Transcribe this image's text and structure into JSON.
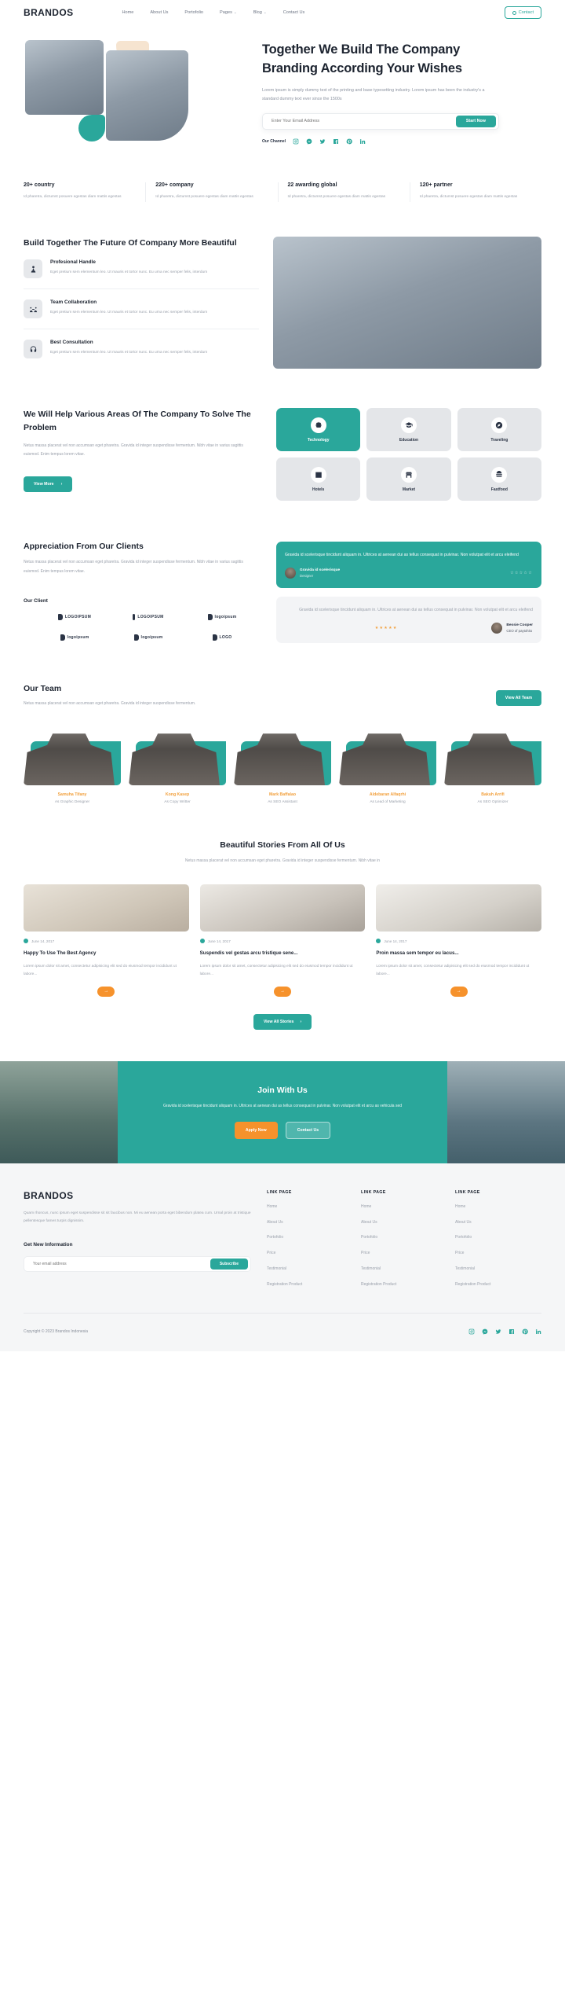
{
  "nav": {
    "brand": "BRANDOS",
    "links": [
      {
        "label": "Home",
        "dropdown": false
      },
      {
        "label": "About Us",
        "dropdown": false
      },
      {
        "label": "Portofolio",
        "dropdown": false
      },
      {
        "label": "Pages",
        "dropdown": true
      },
      {
        "label": "Blog",
        "dropdown": true
      },
      {
        "label": "Contact Us",
        "dropdown": false
      }
    ],
    "cta": "Contact",
    "cta_icon": "phone-icon"
  },
  "hero": {
    "title": "Together We Build The Company Branding According Your Wishes",
    "paragraph": "Lorem ipsum is simply dummy text of the printing and base typesetting industry. Lorem ipsum has been the industry's a standard dummy text ever since the 1500s",
    "email_placeholder": "Enter Your Email Address",
    "email_value": "",
    "cta": "Start Now",
    "channel_label": "Our Channel",
    "socials": [
      "instagram-icon",
      "messenger-icon",
      "twitter-icon",
      "facebook-icon",
      "pinterest-icon",
      "linkedin-icon"
    ]
  },
  "stats": [
    {
      "value": "20+ country",
      "desc": "Id pharetra, dictumst posuere egestas diam mattis egestas"
    },
    {
      "value": "220+ company",
      "desc": "Id pharetra, dictumst posuere egestas diam mattis egestas"
    },
    {
      "value": "22 awarding global",
      "desc": "Id pharetra, dictumst posuere egestas diam mattis egestas"
    },
    {
      "value": "120+ partner",
      "desc": "Id pharetra, dictumst posuere egestas diam mattis egestas"
    }
  ],
  "build": {
    "title": "Build Together The Future Of Company More Beautiful",
    "features": [
      {
        "icon": "person-tie-icon",
        "title": "Profesional Handle",
        "desc": "Eget pretium sem elementum leo. Ut mauris et tortor nunc. Eu urna nec semper felis, interdum"
      },
      {
        "icon": "team-icon",
        "title": "Team Collaboration",
        "desc": "Eget pretium sem elementum leo. Ut mauris et tortor nunc. Eu urna nec semper felis, interdum"
      },
      {
        "icon": "headset-icon",
        "title": "Best Consultation",
        "desc": "Eget pretium sem elementum leo. Ut mauris et tortor nunc. Eu urna nec semper felis, interdum"
      }
    ]
  },
  "solve": {
    "title": "We Will Help Various Areas Of The Company To Solve The Problem",
    "paragraph": "Netus massa placerat vel non accumsan eget pharetra. Gravida id integer suspendisse fermentum. Nibh vitae in varius sagittis euismod. Enim tempus lorem vitae.",
    "button": "View More",
    "categories": [
      {
        "label": "Technology",
        "icon": "robot-icon",
        "active": true
      },
      {
        "label": "Education",
        "icon": "graduation-cap-icon",
        "active": false
      },
      {
        "label": "Traveling",
        "icon": "compass-icon",
        "active": false
      },
      {
        "label": "Hotels",
        "icon": "hotel-icon",
        "active": false
      },
      {
        "label": "Market",
        "icon": "store-icon",
        "active": false
      },
      {
        "label": "Fastfood",
        "icon": "burger-icon",
        "active": false
      }
    ]
  },
  "testimonial": {
    "title": "Appreciation From Our Clients",
    "paragraph": "Netus massa placerat vel non accumsan eget pharetra. Gravida id integer suspendisse fermentum. Nibh vitae in varius sagittis euismod. Enim tempus lorem vitae.",
    "client_title": "Our Client",
    "client_logos": [
      "LOGOIPSUM",
      "LOGOIPSUM",
      "logoipsum",
      "logoipsum",
      "logoipsum",
      "LOGO"
    ],
    "cards": [
      {
        "text": "Gravida id scelerisque tincidunt aliquam in. Ultrices at aenean dui as tellus consequat in pulvinar. Non volutpat elit et arcu eleifend",
        "name": "Gravida id scelerisque",
        "role": "Designer",
        "stars": "☆☆☆☆☆",
        "theme": "teal"
      },
      {
        "text": "Gravida id scelerisque tincidunt aliquam in. Ultrices at aenean dui as tellus consequat in pulvinar. Non volutpat elit et arcu eleifend",
        "name": "Bessie Cooper",
        "role": "CEO of paytohito",
        "stars": "★★★★★",
        "theme": "grey"
      }
    ]
  },
  "team": {
    "title": "Our Team",
    "paragraph": "Netus massa placerat vel non accumsan eget pharetra. Gravida id integer suspendisse fermentum.",
    "button": "View All Team",
    "members": [
      {
        "name": "Samuha Tifany",
        "role": "As Graphic Designer"
      },
      {
        "name": "Kong Kasep",
        "role": "As Copy Writter"
      },
      {
        "name": "Mark Baffalao",
        "role": "As SEO Assistant"
      },
      {
        "name": "Aldebaran Alfaqrhi",
        "role": "As Lead of Marketing"
      },
      {
        "name": "Bakuh Arrifi",
        "role": "As SEO Optimizer"
      }
    ]
  },
  "blog": {
    "title": "Beautiful Stories From All Of Us",
    "subtitle": "Netus massa placerat vel non accumsan eget pharetra. Gravida id integer suspendisse fermentum. Nibh vitae in",
    "button": "View All Stories",
    "posts": [
      {
        "date": "June 14, 2017",
        "title": "Happy To Use The Best Agency",
        "excerpt": "Lorem ipsum dolor sit amet, consectetur adipisicing elit sed do eiusmod tempor incididunt ut labore...",
        "arrow": "→"
      },
      {
        "date": "June 14, 2017",
        "title": "Suspendis vel gestas arcu tristique sene...",
        "excerpt": "Lorem ipsum dolor sit amet, consectetur adipisicing elit sed do eiusmod tempor incididunt ut labore...",
        "arrow": "→"
      },
      {
        "date": "June 14, 2017",
        "title": "Proin massa sem tempor eu lacus...",
        "excerpt": "Lorem ipsum dolor sit amet, consectetur adipisicing elit sed do eiusmod tempor incididunt ut labore...",
        "arrow": "→"
      }
    ]
  },
  "join": {
    "title": "Join With Us",
    "paragraph": "Gravida id scelerisque tincidunt aliquam in. Ultrices at aenean dui as tellus consequat in pulvinar. Non volutpat elit et arcu as vehicula sed",
    "primary": "Apply Now",
    "secondary": "Contact Us"
  },
  "footer": {
    "brand": "BRANDOS",
    "desc": "Quam rhoncus, nunc ipsum eget suspendisse sit sit faucibus non. Mi eu aenean porta eget bibendum platea cum. Urnal proin at tristique pellentesque fames turpis dignissim.",
    "newsletter_title": "Get New Information",
    "email_placeholder": "Your email address",
    "email_value": "",
    "subscribe": "Subscribe",
    "columns": [
      {
        "title": "LINK PAGE",
        "links": [
          "Home",
          "About Us",
          "Portofolio",
          "Price",
          "Testimonial",
          "Registration Product"
        ]
      },
      {
        "title": "LINK PAGE",
        "links": [
          "Home",
          "About Us",
          "Portofolio",
          "Price",
          "Testimonial",
          "Registration Product"
        ]
      },
      {
        "title": "LINK PAGE",
        "links": [
          "Home",
          "About Us",
          "Portofolio",
          "Price",
          "Testimonial",
          "Registration Product"
        ]
      }
    ],
    "copyright": "Copyright © 2023 Brandos Indonesia",
    "socials": [
      "instagram-icon",
      "messenger-icon",
      "twitter-icon",
      "facebook-icon",
      "pinterest-icon",
      "linkedin-icon"
    ]
  },
  "colors": {
    "accent_teal": "#2aa79b",
    "accent_orange": "#f6922c",
    "text_dark": "#1d2430",
    "text_muted": "#9aa0ab"
  }
}
